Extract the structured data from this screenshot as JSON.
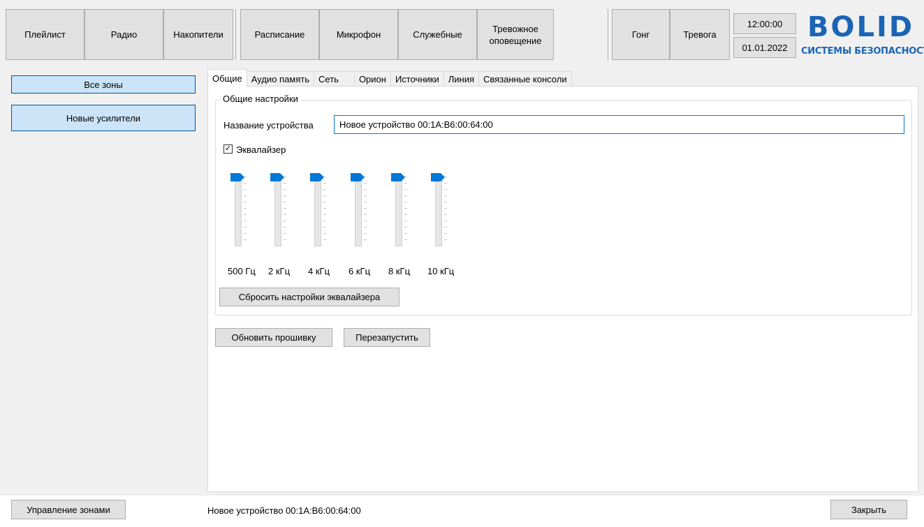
{
  "topbar": {
    "buttons": [
      "Плейлист",
      "Радио",
      "Накопители",
      "Расписание",
      "Микрофон",
      "Служебные",
      "Тревожное оповещение",
      "Гонг",
      "Тревога"
    ],
    "time": "12:00:00",
    "date": "01.01.2022"
  },
  "logo": {
    "word": "BOLID",
    "subtitle": "СИСТЕМЫ БЕЗОПАСНОСТИ"
  },
  "sidebar": {
    "zones": [
      "Все зоны",
      "Новые усилители"
    ],
    "manage_zones_label": "Управление зонами"
  },
  "tabs": [
    "Общие",
    "Аудио память",
    "Сеть",
    "Орион",
    "Источники",
    "Линия",
    "Связанные консоли"
  ],
  "general": {
    "group_title": "Общие настройки",
    "device_name_label": "Название устройства",
    "device_name_value": "Новое устройство 00:1A:B6:00:64:00",
    "equalizer_label": "Эквалайзер",
    "equalizer_checked": true,
    "equalizer_bands": [
      {
        "label": "500 Гц",
        "level": 1.0
      },
      {
        "label": "2 кГц",
        "level": 1.0
      },
      {
        "label": "4 кГц",
        "level": 1.0
      },
      {
        "label": "6 кГц",
        "level": 1.0
      },
      {
        "label": "8 кГц",
        "level": 1.0
      },
      {
        "label": "10 кГц",
        "level": 1.0
      }
    ],
    "reset_eq_label": "Сбросить настройки эквалайзера"
  },
  "actions": {
    "update_firmware_label": "Обновить прошивку",
    "restart_label": "Перезапустить",
    "close_label": "Закрыть"
  },
  "status": {
    "device_name": "Новое устройство 00:1A:B6:00:64:00"
  },
  "colors": {
    "accent": "#0078d7",
    "logo_blue": "#1b64b6",
    "zone_button_bg": "#cce4f7"
  }
}
